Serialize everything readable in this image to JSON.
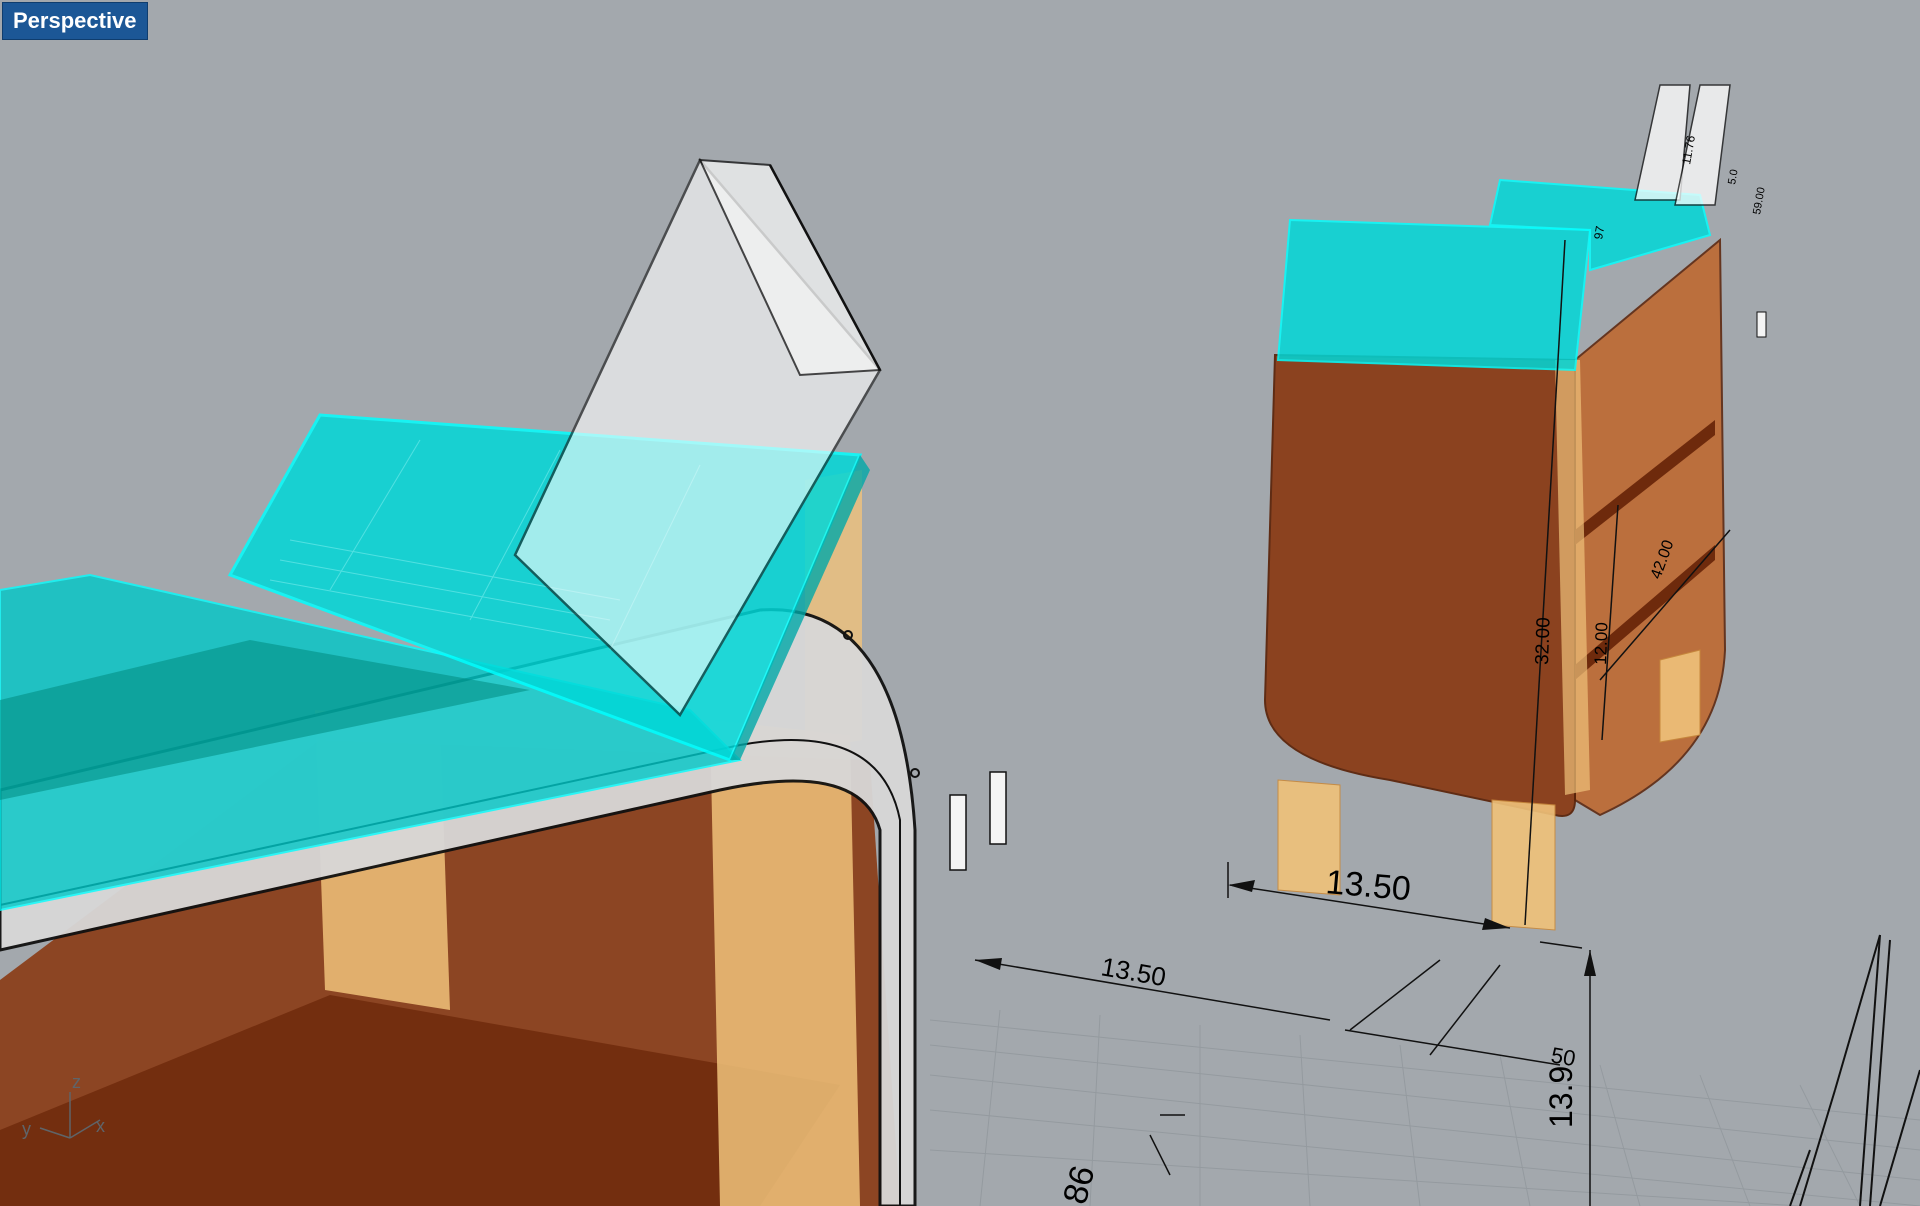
{
  "viewport": {
    "name": "Perspective",
    "colors": {
      "background": "#a3a8ad",
      "glass": "#00d8d8",
      "wood_dark": "#8a3a14",
      "wood_light": "#f0c27a",
      "tab": "#1c5796"
    }
  },
  "axes": {
    "x": "x",
    "y": "y",
    "z": "z"
  },
  "dimensions": {
    "cabinet_width": "13.50",
    "floor_width": "13.50",
    "floor_small": "50",
    "floor_height": "13.9",
    "floor_bottom": "86",
    "cabinet_height": "32.00",
    "shelf_gap": "12.00",
    "shelf_diag": "42.00",
    "top_small_1": "11.76",
    "top_small_2": "59.00",
    "top_small_3": "5.0",
    "top_small_4": "97"
  }
}
